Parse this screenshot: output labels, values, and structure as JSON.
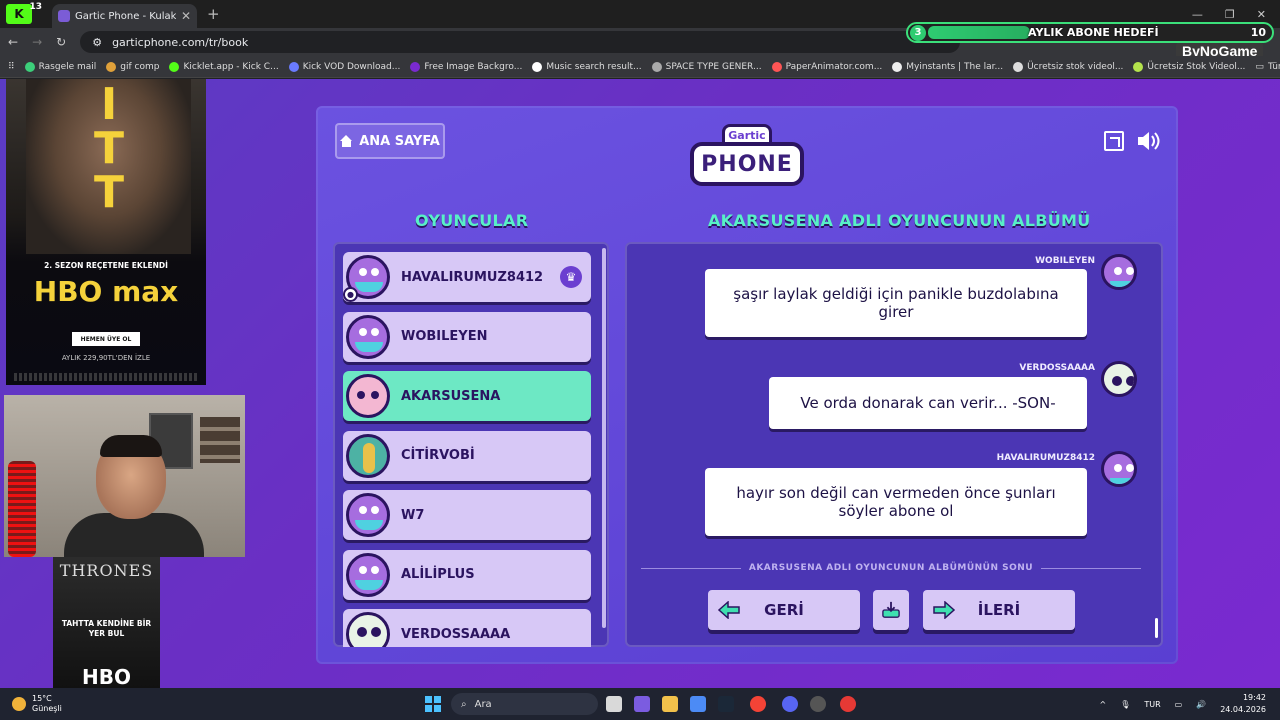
{
  "browser": {
    "kick_badge": "K",
    "kick_count": "13",
    "tab_title": "Gartic Phone - Kulaktan Ku",
    "url": "garticphone.com/tr/book",
    "bookmarks": [
      "Rasgele mail",
      "gif comp",
      "Kicklet.app - Kick C...",
      "Kick VOD Download...",
      "Free Image Backgro...",
      "Music search result...",
      "SPACE TYPE GENER...",
      "PaperAnimator.com...",
      "Myinstants | The lar...",
      "Ücretsiz stok videol...",
      "Ücretsiz Stok Videol..."
    ],
    "bookmarks_folder": "Tüm Yer İşaretleri"
  },
  "overlay": {
    "goal_current": "3",
    "goal_label": "AYLIK ABONE HEDEFİ",
    "goal_max": "10",
    "goal_progress": 0.3,
    "sponsor": "ByNoGame"
  },
  "game": {
    "home_label": "ANA SAYFA",
    "logo_top": "Gartic",
    "logo_main": "PHONE",
    "players_title": "OYUNCULAR",
    "album_title": "AKARSUSENA ADLI OYUNCUNUN ALBÜMÜ",
    "players": [
      {
        "name": "HAVALIRUMUZ8412",
        "avatar": "purple-bird",
        "host": true,
        "active": false
      },
      {
        "name": "WOBILEYEN",
        "avatar": "purple-bird",
        "host": false,
        "active": false
      },
      {
        "name": "AKARSUSENA",
        "avatar": "unicorn",
        "host": false,
        "active": true
      },
      {
        "name": "CİTİRVOBİ",
        "avatar": "beetle",
        "host": false,
        "active": false
      },
      {
        "name": "W7",
        "avatar": "purple-bird",
        "host": false,
        "active": false
      },
      {
        "name": "ALİLİPLUS",
        "avatar": "purple-bird",
        "host": false,
        "active": false
      },
      {
        "name": "VERDOSSAAAA",
        "avatar": "panda",
        "host": false,
        "active": false
      }
    ],
    "messages": [
      {
        "author": "WOBILEYEN",
        "text": "şaşır laylak geldiği için panikle buzdolabına girer",
        "avatar": "purple-bird"
      },
      {
        "author": "VERDOSSAAAA",
        "text": "Ve orda donarak can verir... -SON-",
        "avatar": "panda"
      },
      {
        "author": "HAVALIRUMUZ8412",
        "text": "hayır son değil can vermeden önce şunları söyler abone ol",
        "avatar": "purple-bird"
      }
    ],
    "album_end": "AKARSUSENA ADLI OYUNCUNUN ALBÜMÜNÜN SONU",
    "back_label": "GERİ",
    "next_label": "İLERİ"
  },
  "ads": {
    "hbo_letters": "TT",
    "hbo_tagline": "2. SEZON REÇETENE EKLENDİ",
    "hbo_logo": "HBO max",
    "hbo_cta": "HEMEN ÜYE OL",
    "hbo_price": "AYLIK 229,90TL'DEN İZLE",
    "thrones_title": "THRONES",
    "thrones_tagline": "TAHTTA KENDİNE BİR YER BUL",
    "thrones_logo": "HBO"
  },
  "taskbar": {
    "temperature": "15°C",
    "weather": "Güneşli",
    "search_placeholder": "Ara",
    "language": "TUR",
    "time": "19:42",
    "date": "24.04.2026"
  },
  "colors": {
    "accent": "#58f0c7",
    "panel": "#5a3fd2",
    "active_player": "#6de8c4",
    "card": "#d7c8f6"
  }
}
